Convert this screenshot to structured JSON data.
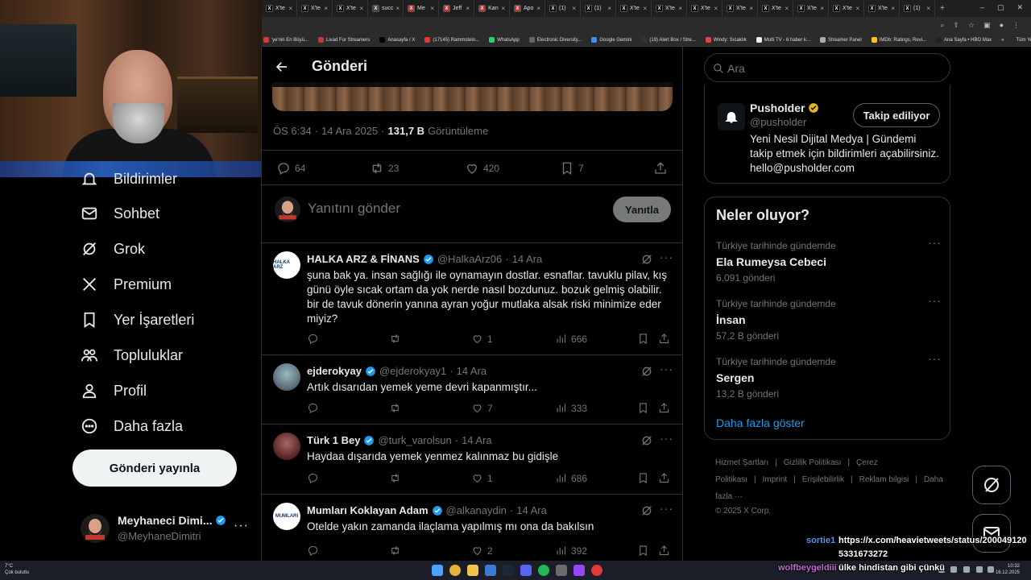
{
  "browser": {
    "tabs": [
      {
        "label": "X'te",
        "color": "#000"
      },
      {
        "label": "X'te",
        "color": "#000"
      },
      {
        "label": "X'te",
        "color": "#000"
      },
      {
        "label": "succ",
        "color": "#444"
      },
      {
        "label": "Me",
        "color": "#c4302b"
      },
      {
        "label": "Jeff",
        "color": "#c4302b"
      },
      {
        "label": "Karı",
        "color": "#c4302b"
      },
      {
        "label": "Apo",
        "color": "#c4302b"
      },
      {
        "label": "(1)",
        "color": "#000"
      },
      {
        "label": "(1)",
        "color": "#000"
      },
      {
        "label": "X'te",
        "color": "#000"
      },
      {
        "label": "X'te",
        "color": "#000"
      },
      {
        "label": "X'te",
        "color": "#000"
      },
      {
        "label": "X'te",
        "color": "#000"
      },
      {
        "label": "X'te",
        "color": "#000"
      },
      {
        "label": "X'te",
        "color": "#000"
      },
      {
        "label": "X'te",
        "color": "#000"
      },
      {
        "label": "X'te",
        "color": "#000"
      },
      {
        "label": "(1)",
        "color": "#000"
      }
    ],
    "bookmarks": [
      "'ye'nin En Büyü...",
      "Livad For Streamers",
      "Anasayfa / X",
      "(17145) Rammstein...",
      "WhatsApp",
      "Electronic Diversity...",
      "Google Gemini",
      "(19) Alert Box / Stre...",
      "Windy: Sıcaklık",
      "Multi TV - 6 haber k...",
      "Streamer Panel",
      "IMDb: Ratings, Revi...",
      "Ana Sayfa • HBO Max"
    ],
    "bookmarks_more": "»",
    "all_bookmarks": "Tüm Yer İşaretleri"
  },
  "nav": {
    "partial_label": "Bildirimler",
    "items": [
      {
        "label": "Sohbet",
        "icon": "mail-icon"
      },
      {
        "label": "Grok",
        "icon": "grok-icon"
      },
      {
        "label": "Premium",
        "icon": "x-logo-icon"
      },
      {
        "label": "Yer İşaretleri",
        "icon": "bookmark-icon"
      },
      {
        "label": "Topluluklar",
        "icon": "communities-icon"
      },
      {
        "label": "Profil",
        "icon": "profile-icon"
      },
      {
        "label": "Daha fazla",
        "icon": "more-circle-icon"
      }
    ],
    "post_button": "Gönderi yayınla",
    "account": {
      "name": "Meyhaneci Dimi...",
      "handle": "@MeyhaneDimitri",
      "more": "···"
    }
  },
  "main": {
    "title": "Gönderi",
    "meta": {
      "time": "ÖS 6:34",
      "sep": "·",
      "date": "14 Ara 2025",
      "sep2": "·",
      "views": "131,7 B",
      "views_label": "Görüntüleme"
    },
    "stats": {
      "replies": "64",
      "reposts": "23",
      "likes": "420",
      "bookmarks": "7"
    },
    "reply_placeholder": "Yanıtını gönder",
    "reply_button": "Yanıtla",
    "replies": [
      {
        "name": "HALKA ARZ & FİNANS",
        "handle": "@HalkaArz06",
        "sep": "·",
        "date": "14 Ara",
        "text": "şuna bak ya. insan sağlığı ile oynamayın dostlar. esnaflar. tavuklu pilav, kış günü öyle sıcak ortam da yok nerde nasıl bozdunuz. bozuk gelmiş olabilir. bir de tavuk dönerin yanına ayran yoğur mutlaka alsak riski minimize eder miyiz?",
        "avatar_text": "HALKA ARZ",
        "likes": "1",
        "views": "666"
      },
      {
        "name": "ejderokyay",
        "handle": "@ejderokyay1",
        "sep": "·",
        "date": "14 Ara",
        "text": "Artık dısarıdan yemek yeme devri kapanmıştır...",
        "likes": "7",
        "views": "333"
      },
      {
        "name": "Türk 1 Bey",
        "handle": "@turk_varolsun",
        "sep": "·",
        "date": "14 Ara",
        "text": "Haydaa dışarıda yemek yenmez kalınmaz bu gidişle",
        "likes": "1",
        "views": "686"
      },
      {
        "name": "Mumları Koklayan Adam",
        "handle": "@alkanaydin",
        "sep": "·",
        "date": "14 Ara",
        "text": "Otelde yakın zamanda ilaçlama yapılmış mı ona da bakılsın",
        "avatar_text": "MUMLARI",
        "likes": "2",
        "views": "392"
      }
    ]
  },
  "right": {
    "search_placeholder": "Ara",
    "follow_card": {
      "name": "Pusholder",
      "handle": "@pusholder",
      "button": "Takip ediliyor",
      "bio": "Yeni Nesil Dijital Medya | Gündemi takip etmek için bildirimleri açabilirsiniz. hello@pusholder.com"
    },
    "trends_title": "Neler oluyor?",
    "trends": [
      {
        "context": "Türkiye tarihinde gündemde",
        "name": "Ela Rumeysa Cebeci",
        "count": "6.091 gönderi"
      },
      {
        "context": "Türkiye tarihinde gündemde",
        "name": "İnsan",
        "count": "57,2 B gönderi"
      },
      {
        "context": "Türkiye tarihinde gündemde",
        "name": "Sergen",
        "count": "13,2 B gönderi"
      }
    ],
    "trends_more": "···",
    "show_more": "Daha fazla göster",
    "footer": {
      "links": [
        "Hizmet Şartları",
        "|",
        "Gizlilik Politikası",
        "|",
        "Çerez Politikası",
        "|",
        "Imprint",
        "|",
        "Erişilebilirlik",
        "|",
        "Reklam bilgisi",
        "|",
        "Daha fazla ···"
      ],
      "copyright": "© 2025 X Corp."
    }
  },
  "overlay": {
    "chat1_user": "sortie1",
    "chat1_msg": "https://x.com/heavietweets/status/200049120",
    "chat1_msg2": "5331673272",
    "chat2_user": "wolfbeygeldiii",
    "chat2_msg": "ülke hindistan gibi çünkü"
  },
  "taskbar": {
    "weather_temp": "7°C",
    "weather_desc": "Çok bulutlu",
    "time": "10:32",
    "date": "16.12.2025"
  },
  "colors": {
    "accent": "#1d9bf0",
    "border": "#2f3336",
    "muted": "#71767b",
    "text": "#e7e9ea"
  }
}
